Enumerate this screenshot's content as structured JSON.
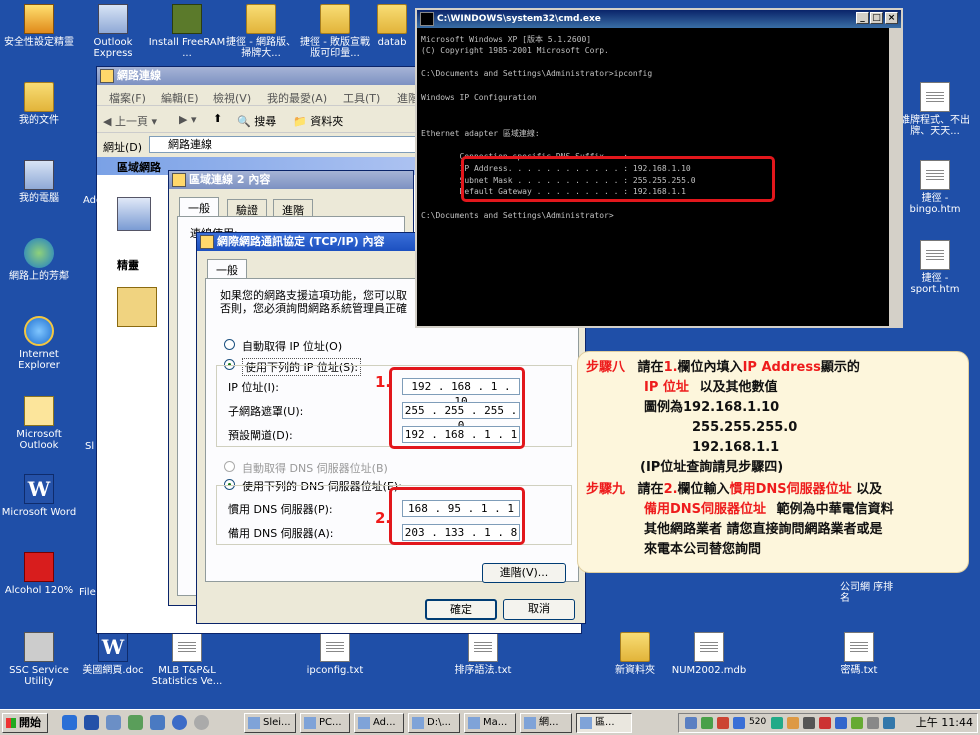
{
  "desktop_icons": [
    {
      "id": "security",
      "label": "安全性設定精靈",
      "icon": "shield-icon"
    },
    {
      "id": "mydocs",
      "label": "我的文件",
      "icon": "folder-icon"
    },
    {
      "id": "mycomputer",
      "label": "我的電腦",
      "icon": "computer-icon"
    },
    {
      "id": "network",
      "label": "網路上的芳鄰",
      "icon": "network-icon"
    },
    {
      "id": "ie",
      "label": "Internet Explorer",
      "icon": "ie-icon"
    },
    {
      "id": "outlook",
      "label": "Microsoft Outlook",
      "icon": "outlook-icon"
    },
    {
      "id": "word",
      "label": "Microsoft Word",
      "icon": "word-icon"
    },
    {
      "id": "acrobat",
      "label": "Alcohol 120%",
      "icon": "alcohol-icon"
    },
    {
      "id": "ssc",
      "label": "SSC Service Utility",
      "icon": "printer-icon"
    },
    {
      "id": "oe",
      "label": "Outlook Express",
      "icon": "mail-icon"
    },
    {
      "id": "freeram",
      "label": "Install FreeRAM ...",
      "icon": "chip-icon"
    },
    {
      "id": "sc1",
      "label": "捷徑 - 網路版、掃牌大...",
      "icon": "folder-icon"
    },
    {
      "id": "sc2",
      "label": "捷徑 - 敗版宣戰版可印量...",
      "icon": "folder-icon"
    },
    {
      "id": "datab",
      "label": "datab",
      "icon": "folder-icon"
    },
    {
      "id": "doc",
      "label": "美國網頁.doc",
      "icon": "word-icon"
    },
    {
      "id": "mlb",
      "label": "MLB T&P&L Statistics Ve...",
      "icon": "file-icon"
    },
    {
      "id": "ipconfig",
      "label": "ipconfig.txt",
      "icon": "file-icon"
    },
    {
      "id": "sort",
      "label": "排序語法.txt",
      "icon": "file-icon"
    },
    {
      "id": "newfolder",
      "label": "新資料夾",
      "icon": "folder-icon"
    },
    {
      "id": "num",
      "label": "NUM2002.mdb",
      "icon": "file-icon"
    },
    {
      "id": "pwd",
      "label": "密碼.txt",
      "icon": "file-icon"
    },
    {
      "id": "bingo",
      "label": "捷徑 - bingo.htm",
      "icon": "ie-icon"
    },
    {
      "id": "sport",
      "label": "捷徑 - sport.htm",
      "icon": "ie-icon"
    },
    {
      "id": "prog",
      "label": "誰牌程式、不出牌、天天...",
      "icon": "ie-icon"
    },
    {
      "id": "company",
      "label": "公司網 序排名",
      "icon": "file-icon"
    }
  ],
  "explorer": {
    "title": "網路連線",
    "menu": [
      "檔案(F)",
      "編輯(E)",
      "檢視(V)",
      "我的最愛(A)",
      "工具(T)",
      "進階"
    ],
    "back": "上一頁",
    "search": "搜尋",
    "folders": "資料夾",
    "address_label": "網址(D)",
    "address_value": "網路連線",
    "section": "區域網路",
    "details": "精靈",
    "side_labels": [
      "Add",
      "Sl",
      "File"
    ]
  },
  "lan_props": {
    "title": "區域連線 2 內容",
    "tabs": [
      "一般",
      "驗證",
      "進階"
    ],
    "connect_using": "連線使用:"
  },
  "tcpip": {
    "title": "網際網路通訊協定 (TCP/IP) 內容",
    "tab": "一般",
    "desc_line1": "如果您的網路支援這項功能，您可以取",
    "desc_line2": "否則，您必須詢問網路系統管理員正確",
    "auto_ip": "自動取得 IP 位址(O)",
    "manual_ip": "使用下列的 IP 位址(S):",
    "ip_label": "IP 位址(I):",
    "mask_label": "子網路遮罩(U):",
    "gw_label": "預設閘道(D):",
    "ip": "192 . 168 . 1 . 10",
    "mask": "255 . 255 . 255 . 0",
    "gateway": "192 . 168 . 1 . 1",
    "auto_dns": "自動取得 DNS 伺服器位址(B)",
    "manual_dns": "使用下列的 DNS 伺服器位址(E):",
    "dns1_label": "慣用 DNS 伺服器(P):",
    "dns2_label": "備用 DNS 伺服器(A):",
    "dns1": "168 . 95 . 1 . 1",
    "dns2": "203 . 133 . 1 . 8",
    "advanced": "進階(V)...",
    "ok": "確定",
    "cancel": "取消",
    "marker1": "1.",
    "marker2": "2."
  },
  "cmd": {
    "title": "C:\\WINDOWS\\system32\\cmd.exe",
    "lines": [
      "Microsoft Windows XP [版本 5.1.2600]",
      "(C) Copyright 1985-2001 Microsoft Corp.",
      "",
      "C:\\Documents and Settings\\Administrator>ipconfig",
      "",
      "Windows IP Configuration",
      "",
      "",
      "Ethernet adapter 區域連線:",
      "",
      "        Connection-specific DNS Suffix  . :",
      "        IP Address. . . . . . . . . . . . : 192.168.1.10",
      "        Subnet Mask . . . . . . . . . . . : 255.255.255.0",
      "        Default Gateway . . . . . . . . . : 192.168.1.1",
      "",
      "C:\\Documents and Settings\\Administrator>"
    ]
  },
  "callout": {
    "step8": "步驟八",
    "step8_a": "請在",
    "step8_b": "1.",
    "step8_c": "欄位內填入",
    "step8_d": "IP Address",
    "step8_e": "顯示的",
    "step8_f": "IP 位址",
    "step8_g": "以及其他數值",
    "example": "圖例為192.168.1.10",
    "example2": "255.255.255.0",
    "example3": "192.168.1.1",
    "note": "(IP位址查詢請見步驟四)",
    "step9": "步驟九",
    "step9_a": "請在",
    "step9_b": "2.",
    "step9_c": "欄位輸入",
    "step9_d": "慣用DNS伺服器位址",
    "step9_e": "以及",
    "step9_f": "備用DNS伺服器位址",
    "step9_g": "範例為中華電信資料",
    "step9_h": "其他網路業者 請您直接詢問網路業者或是",
    "step9_i": "來電本公司替您詢問"
  },
  "taskbar": {
    "start": "開始",
    "tasks": [
      "Slei...",
      "PC...",
      "Ad...",
      "D:\\...",
      "Ma...",
      "網...",
      "區..."
    ],
    "clock": "上午 11:44",
    "tray_text": "520"
  }
}
